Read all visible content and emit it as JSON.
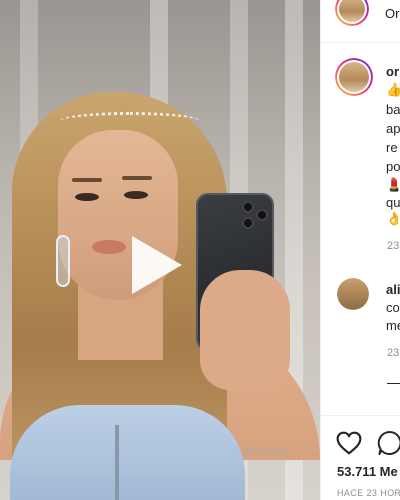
{
  "header": {
    "username_truncated": "Ori"
  },
  "caption": {
    "username_truncated": "or",
    "lines": [
      "ba",
      "ap",
      "re",
      "po",
      "qu"
    ],
    "emoji_1": "👍",
    "emoji_2": "💄",
    "emoji_3": "👌",
    "time": "23"
  },
  "comment": {
    "username_truncated": "ali",
    "lines": [
      "co",
      "me"
    ],
    "time": "23"
  },
  "actions": {
    "like_icon": "heart-icon",
    "comment_icon": "comment-icon"
  },
  "stats": {
    "likes": "53.711 Me",
    "posted": "HACE 23 HOR"
  },
  "media": {
    "play_icon": "play-icon"
  }
}
